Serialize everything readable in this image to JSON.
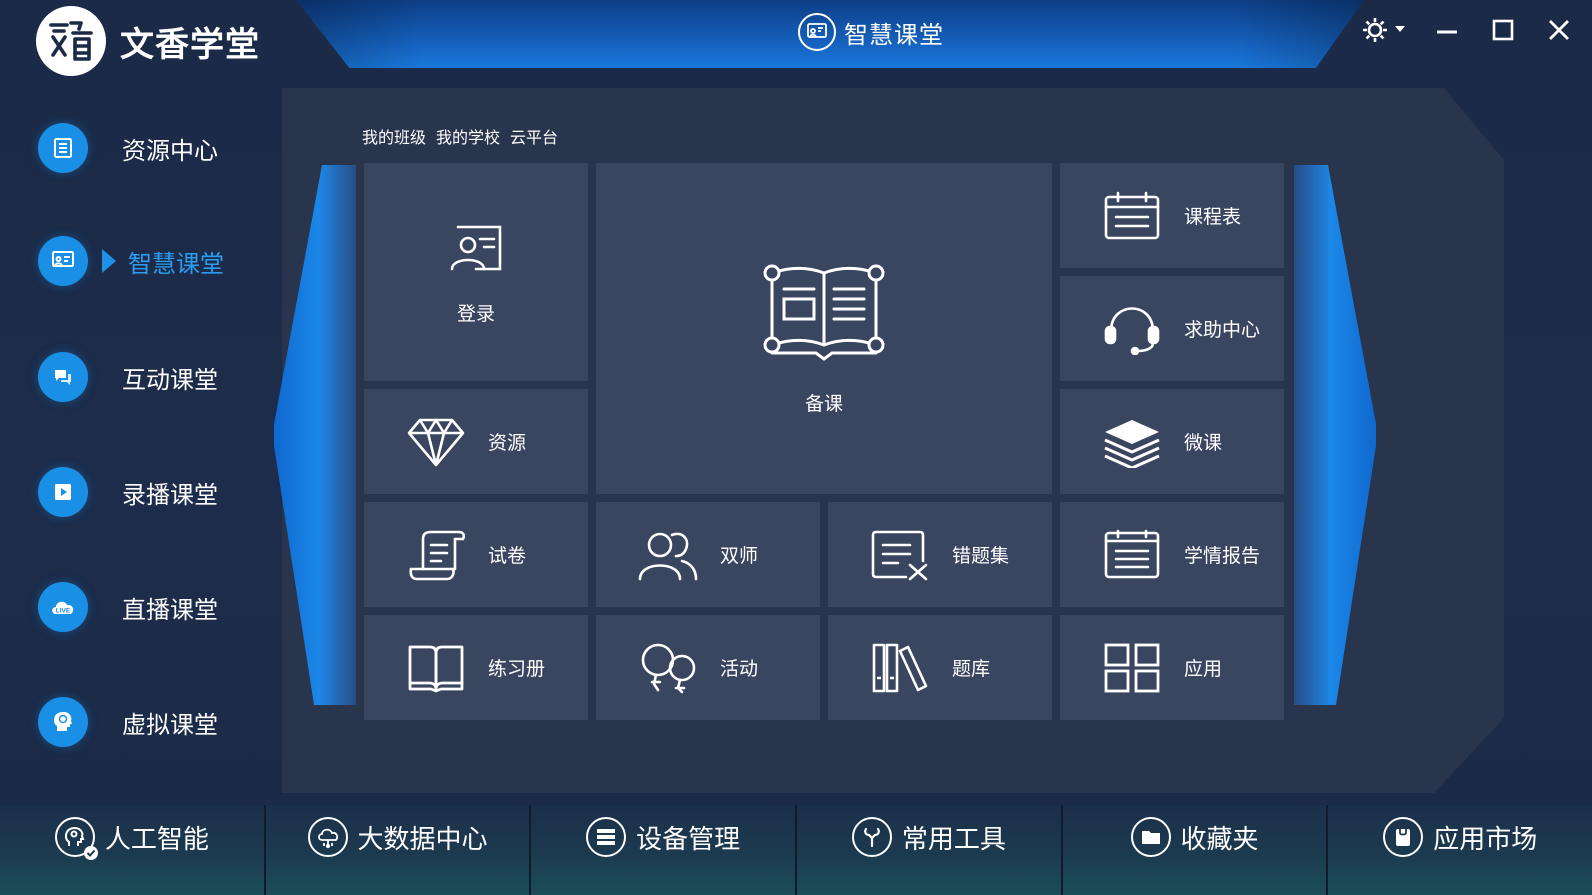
{
  "app": {
    "name": "文香学堂",
    "title": "智慧课堂"
  },
  "sidebar": {
    "items": [
      {
        "label": "资源中心",
        "icon": "list-icon"
      },
      {
        "label": "智慧课堂",
        "icon": "teacher-board-icon",
        "active": true
      },
      {
        "label": "互动课堂",
        "icon": "chat-bubbles-icon"
      },
      {
        "label": "录播课堂",
        "icon": "play-icon"
      },
      {
        "label": "直播课堂",
        "icon": "live-cloud-icon"
      },
      {
        "label": "虚拟课堂",
        "icon": "vr-head-icon"
      }
    ]
  },
  "tabs": [
    "我的班级",
    "我的学校",
    "云平台"
  ],
  "tiles": {
    "login": "登录",
    "prepare": "备课",
    "schedule": "课程表",
    "help": "求助中心",
    "resources": "资源",
    "microlesson": "微课",
    "exam": "试卷",
    "dualteacher": "双师",
    "mistakes": "错题集",
    "report": "学情报告",
    "workbook": "练习册",
    "activity": "活动",
    "questionbank": "题库",
    "apps": "应用"
  },
  "bottom": [
    {
      "label": "人工智能",
      "icon": "ai-head-icon"
    },
    {
      "label": "大数据中心",
      "icon": "cloud-data-icon"
    },
    {
      "label": "设备管理",
      "icon": "server-icon"
    },
    {
      "label": "常用工具",
      "icon": "tools-icon"
    },
    {
      "label": "收藏夹",
      "icon": "folder-icon"
    },
    {
      "label": "应用市场",
      "icon": "store-icon"
    }
  ],
  "colors": {
    "accent": "#1a8fe6",
    "active_text": "#2a9cf2",
    "tile": "#3a4660",
    "panel": "#28354d"
  }
}
